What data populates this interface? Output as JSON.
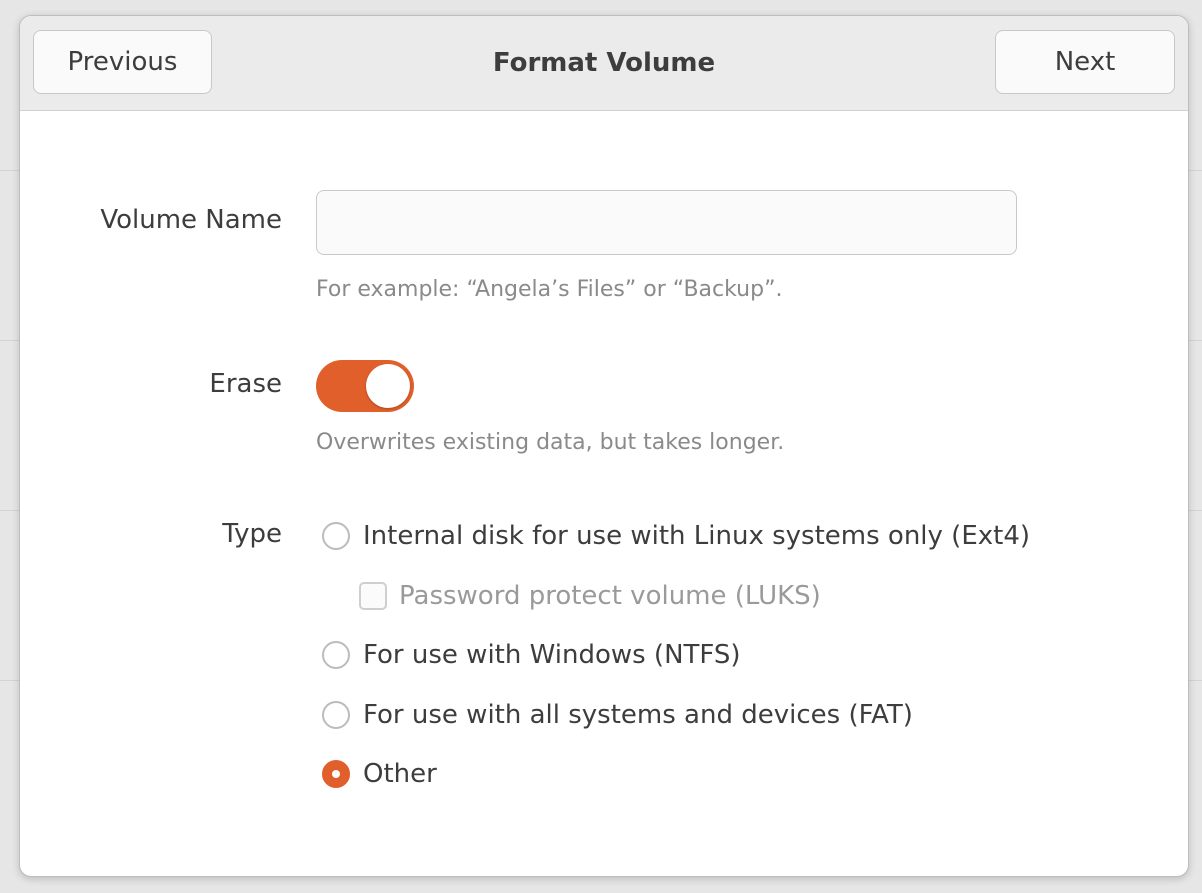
{
  "dialog": {
    "title": "Format Volume",
    "previous_label": "Previous",
    "next_label": "Next"
  },
  "volume_name": {
    "label": "Volume Name",
    "value": "",
    "hint": "For example: “Angela’s Files” or “Backup”."
  },
  "erase": {
    "label": "Erase",
    "enabled": true,
    "hint": "Overwrites existing data, but takes longer."
  },
  "type": {
    "label": "Type",
    "options": [
      {
        "label": "Internal disk for use with Linux systems only (Ext4)",
        "selected": false
      },
      {
        "label": "For use with Windows (NTFS)",
        "selected": false
      },
      {
        "label": "For use with all systems and devices (FAT)",
        "selected": false
      },
      {
        "label": "Other",
        "selected": true
      }
    ],
    "password_protect": {
      "label": "Password protect volume (LUKS)",
      "checked": false,
      "enabled": false
    }
  },
  "colors": {
    "accent": "#e05f2a",
    "header_bg": "#ebebeb",
    "text": "#3d3d3d",
    "hint_text": "#8a8a8a"
  }
}
